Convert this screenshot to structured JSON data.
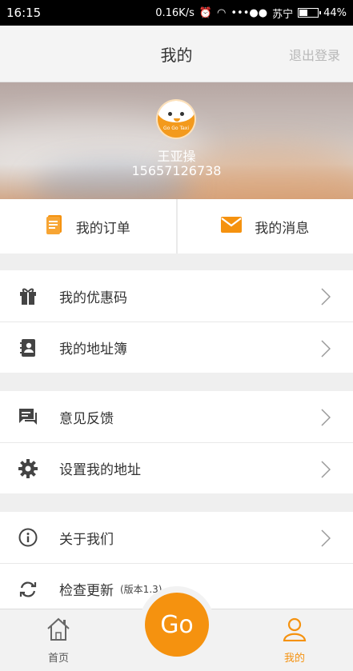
{
  "status_bar": {
    "time": "16:15",
    "speed": "0.16K/s",
    "carrier": "苏宁",
    "battery": "44%"
  },
  "header": {
    "title": "我的",
    "logout": "退出登录"
  },
  "profile": {
    "name": "王亚操",
    "phone": "15657126738",
    "avatar_text": "Go Go Taxi"
  },
  "quick": [
    {
      "label": "我的订单",
      "icon": "order-document-icon"
    },
    {
      "label": "我的消息",
      "icon": "envelope-icon"
    }
  ],
  "menu_groups": [
    [
      {
        "label": "我的优惠码",
        "icon": "gift-icon"
      },
      {
        "label": "我的地址簿",
        "icon": "address-book-icon"
      }
    ],
    [
      {
        "label": "意见反馈",
        "icon": "chat-icon"
      },
      {
        "label": "设置我的地址",
        "icon": "gear-icon"
      }
    ],
    [
      {
        "label": "关于我们",
        "icon": "info-icon"
      },
      {
        "label": "检查更新",
        "icon": "refresh-icon",
        "version": "(版本1.3)"
      }
    ]
  ],
  "tabbar": {
    "home": "首页",
    "go": "Go",
    "mine": "我的"
  },
  "colors": {
    "accent": "#f5920f",
    "muted_text": "#b8b8b8"
  }
}
